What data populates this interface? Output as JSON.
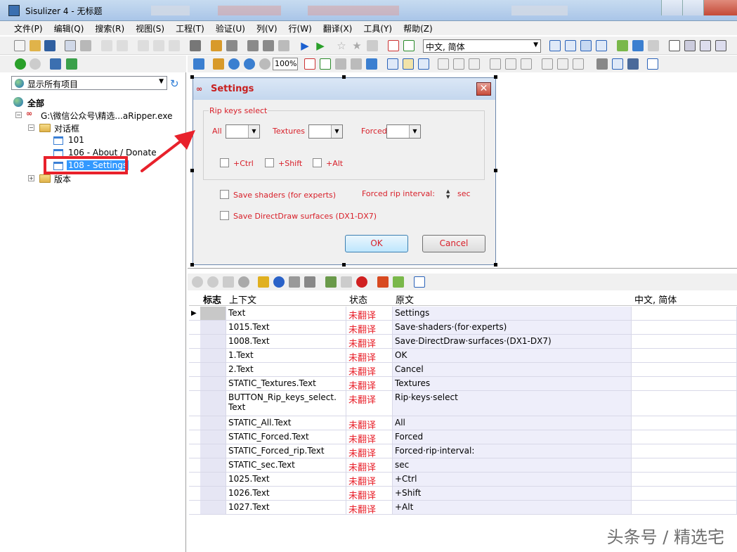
{
  "window": {
    "title": "Sisulizer 4 - 无标题"
  },
  "menu": [
    "文件(P)",
    "编辑(Q)",
    "搜索(R)",
    "视图(S)",
    "工程(T)",
    "验证(U)",
    "列(V)",
    "行(W)",
    "翻译(X)",
    "工具(Y)",
    "帮助(Z)"
  ],
  "toolbar": {
    "language": "中文, 简体"
  },
  "left": {
    "filter": "显示所有项目",
    "tree": {
      "root": "全部",
      "file": "G:\\微信公众号\\精选...aRipper.exe",
      "dialogs_folder": "对话框",
      "items": [
        "101",
        "106 - About / Donate",
        "108 - Settings"
      ],
      "versions_folder": "版本"
    }
  },
  "designer": {
    "zoom": "100%"
  },
  "dialog": {
    "title": "Settings",
    "group_title": "Rip keys select",
    "all_label": "All",
    "textures_label": "Textures",
    "forced_label": "Forced",
    "ctrl_label": "+Ctrl",
    "shift_label": "+Shift",
    "alt_label": "+Alt",
    "save_shaders": "Save shaders (for experts)",
    "forced_interval": "Forced rip interval:",
    "sec": "sec",
    "save_ddraw": "Save DirectDraw surfaces (DX1-DX7)",
    "ok": "OK",
    "cancel": "Cancel"
  },
  "grid": {
    "headers": {
      "flag": "标志",
      "context": "上下文",
      "status": "状态",
      "original": "原文",
      "translation": "中文, 简体"
    },
    "rows": [
      {
        "context": "Text",
        "status": "未翻译",
        "original": "Settings"
      },
      {
        "context": "1015.Text",
        "status": "未翻译",
        "original": "Save·shaders·(for·experts)"
      },
      {
        "context": "1008.Text",
        "status": "未翻译",
        "original": "Save·DirectDraw·surfaces·(DX1-DX7)"
      },
      {
        "context": "1.Text",
        "status": "未翻译",
        "original": "OK"
      },
      {
        "context": "2.Text",
        "status": "未翻译",
        "original": "Cancel"
      },
      {
        "context": "STATIC_Textures.Text",
        "status": "未翻译",
        "original": "Textures"
      },
      {
        "context": "BUTTON_Rip_keys_select.",
        "context2": "Text",
        "status": "未翻译",
        "original": "Rip·keys·select"
      },
      {
        "context": "STATIC_All.Text",
        "status": "未翻译",
        "original": "All"
      },
      {
        "context": "STATIC_Forced.Text",
        "status": "未翻译",
        "original": "Forced"
      },
      {
        "context": "STATIC_Forced_rip.Text",
        "status": "未翻译",
        "original": "Forced·rip·interval:"
      },
      {
        "context": "STATIC_sec.Text",
        "status": "未翻译",
        "original": "sec"
      },
      {
        "context": "1025.Text",
        "status": "未翻译",
        "original": "+Ctrl"
      },
      {
        "context": "1026.Text",
        "status": "未翻译",
        "original": "+Shift"
      },
      {
        "context": "1027.Text",
        "status": "未翻译",
        "original": "+Alt"
      }
    ]
  },
  "watermark": "头条号 / 精选宅"
}
